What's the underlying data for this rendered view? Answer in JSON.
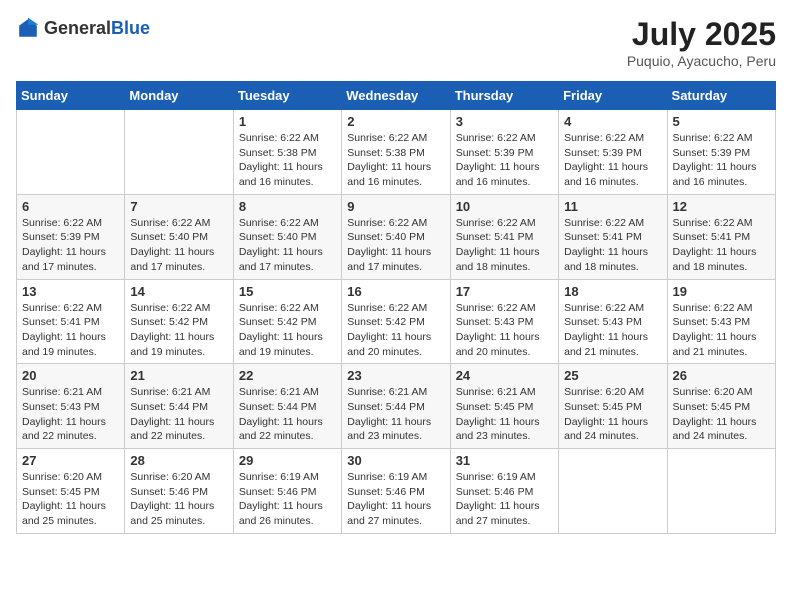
{
  "header": {
    "logo_general": "General",
    "logo_blue": "Blue",
    "month_year": "July 2025",
    "location": "Puquio, Ayacucho, Peru"
  },
  "weekdays": [
    "Sunday",
    "Monday",
    "Tuesday",
    "Wednesday",
    "Thursday",
    "Friday",
    "Saturday"
  ],
  "weeks": [
    [
      null,
      null,
      {
        "day": 1,
        "sunrise": "6:22 AM",
        "sunset": "5:38 PM",
        "daylight": "11 hours and 16 minutes."
      },
      {
        "day": 2,
        "sunrise": "6:22 AM",
        "sunset": "5:38 PM",
        "daylight": "11 hours and 16 minutes."
      },
      {
        "day": 3,
        "sunrise": "6:22 AM",
        "sunset": "5:39 PM",
        "daylight": "11 hours and 16 minutes."
      },
      {
        "day": 4,
        "sunrise": "6:22 AM",
        "sunset": "5:39 PM",
        "daylight": "11 hours and 16 minutes."
      },
      {
        "day": 5,
        "sunrise": "6:22 AM",
        "sunset": "5:39 PM",
        "daylight": "11 hours and 16 minutes."
      }
    ],
    [
      {
        "day": 6,
        "sunrise": "6:22 AM",
        "sunset": "5:39 PM",
        "daylight": "11 hours and 17 minutes."
      },
      {
        "day": 7,
        "sunrise": "6:22 AM",
        "sunset": "5:40 PM",
        "daylight": "11 hours and 17 minutes."
      },
      {
        "day": 8,
        "sunrise": "6:22 AM",
        "sunset": "5:40 PM",
        "daylight": "11 hours and 17 minutes."
      },
      {
        "day": 9,
        "sunrise": "6:22 AM",
        "sunset": "5:40 PM",
        "daylight": "11 hours and 17 minutes."
      },
      {
        "day": 10,
        "sunrise": "6:22 AM",
        "sunset": "5:41 PM",
        "daylight": "11 hours and 18 minutes."
      },
      {
        "day": 11,
        "sunrise": "6:22 AM",
        "sunset": "5:41 PM",
        "daylight": "11 hours and 18 minutes."
      },
      {
        "day": 12,
        "sunrise": "6:22 AM",
        "sunset": "5:41 PM",
        "daylight": "11 hours and 18 minutes."
      }
    ],
    [
      {
        "day": 13,
        "sunrise": "6:22 AM",
        "sunset": "5:41 PM",
        "daylight": "11 hours and 19 minutes."
      },
      {
        "day": 14,
        "sunrise": "6:22 AM",
        "sunset": "5:42 PM",
        "daylight": "11 hours and 19 minutes."
      },
      {
        "day": 15,
        "sunrise": "6:22 AM",
        "sunset": "5:42 PM",
        "daylight": "11 hours and 19 minutes."
      },
      {
        "day": 16,
        "sunrise": "6:22 AM",
        "sunset": "5:42 PM",
        "daylight": "11 hours and 20 minutes."
      },
      {
        "day": 17,
        "sunrise": "6:22 AM",
        "sunset": "5:43 PM",
        "daylight": "11 hours and 20 minutes."
      },
      {
        "day": 18,
        "sunrise": "6:22 AM",
        "sunset": "5:43 PM",
        "daylight": "11 hours and 21 minutes."
      },
      {
        "day": 19,
        "sunrise": "6:22 AM",
        "sunset": "5:43 PM",
        "daylight": "11 hours and 21 minutes."
      }
    ],
    [
      {
        "day": 20,
        "sunrise": "6:21 AM",
        "sunset": "5:43 PM",
        "daylight": "11 hours and 22 minutes."
      },
      {
        "day": 21,
        "sunrise": "6:21 AM",
        "sunset": "5:44 PM",
        "daylight": "11 hours and 22 minutes."
      },
      {
        "day": 22,
        "sunrise": "6:21 AM",
        "sunset": "5:44 PM",
        "daylight": "11 hours and 22 minutes."
      },
      {
        "day": 23,
        "sunrise": "6:21 AM",
        "sunset": "5:44 PM",
        "daylight": "11 hours and 23 minutes."
      },
      {
        "day": 24,
        "sunrise": "6:21 AM",
        "sunset": "5:45 PM",
        "daylight": "11 hours and 23 minutes."
      },
      {
        "day": 25,
        "sunrise": "6:20 AM",
        "sunset": "5:45 PM",
        "daylight": "11 hours and 24 minutes."
      },
      {
        "day": 26,
        "sunrise": "6:20 AM",
        "sunset": "5:45 PM",
        "daylight": "11 hours and 24 minutes."
      }
    ],
    [
      {
        "day": 27,
        "sunrise": "6:20 AM",
        "sunset": "5:45 PM",
        "daylight": "11 hours and 25 minutes."
      },
      {
        "day": 28,
        "sunrise": "6:20 AM",
        "sunset": "5:46 PM",
        "daylight": "11 hours and 25 minutes."
      },
      {
        "day": 29,
        "sunrise": "6:19 AM",
        "sunset": "5:46 PM",
        "daylight": "11 hours and 26 minutes."
      },
      {
        "day": 30,
        "sunrise": "6:19 AM",
        "sunset": "5:46 PM",
        "daylight": "11 hours and 27 minutes."
      },
      {
        "day": 31,
        "sunrise": "6:19 AM",
        "sunset": "5:46 PM",
        "daylight": "11 hours and 27 minutes."
      },
      null,
      null
    ]
  ]
}
